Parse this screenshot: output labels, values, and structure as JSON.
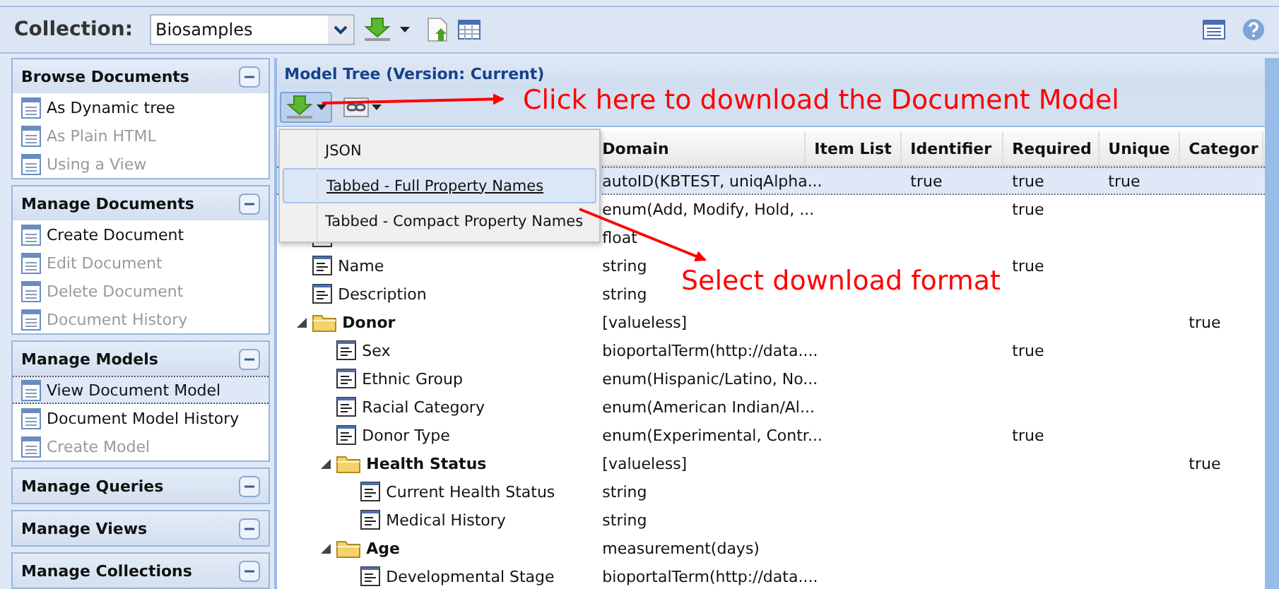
{
  "toolbar": {
    "collection_label": "Collection:",
    "collection_value": "Biosamples"
  },
  "sidebar": {
    "sections": [
      {
        "title": "Browse Documents",
        "items": [
          {
            "label": "As Dynamic tree",
            "disabled": false,
            "selected": false
          },
          {
            "label": "As Plain HTML",
            "disabled": true,
            "selected": false
          },
          {
            "label": "Using a View",
            "disabled": true,
            "selected": false
          }
        ]
      },
      {
        "title": "Manage Documents",
        "items": [
          {
            "label": "Create Document",
            "disabled": false,
            "selected": false
          },
          {
            "label": "Edit Document",
            "disabled": true,
            "selected": false
          },
          {
            "label": "Delete Document",
            "disabled": true,
            "selected": false
          },
          {
            "label": "Document History",
            "disabled": true,
            "selected": false
          }
        ]
      },
      {
        "title": "Manage Models",
        "items": [
          {
            "label": "View Document Model",
            "disabled": false,
            "selected": true
          },
          {
            "label": "Document Model History",
            "disabled": false,
            "selected": false
          },
          {
            "label": "Create Model",
            "disabled": true,
            "selected": false
          }
        ]
      },
      {
        "title": "Manage Queries"
      },
      {
        "title": "Manage Views"
      },
      {
        "title": "Manage Collections"
      }
    ]
  },
  "panel": {
    "title": "Model Tree (Version: Current)",
    "columns": [
      "Domain",
      "Item List",
      "Identifier",
      "Required",
      "Unique",
      "Categor"
    ],
    "tree": [
      {
        "kind": "covered",
        "selected": true,
        "domain": "autoID(KBTEST, uniqAlpha...",
        "identifier": "true",
        "required": "true",
        "unique": "true"
      },
      {
        "kind": "covered",
        "selected": false,
        "domain": "enum(Add, Modify, Hold, ...",
        "required": "true"
      },
      {
        "kind": "field",
        "selected": false,
        "domain": "float"
      },
      {
        "kind": "field",
        "selected": false,
        "name": "Name",
        "domain": "string",
        "required": "true"
      },
      {
        "kind": "field",
        "selected": false,
        "name": "Description",
        "domain": "string"
      },
      {
        "kind": "group",
        "selected": false,
        "name": "Donor",
        "domain": "[valueless]",
        "category": "true",
        "children": [
          {
            "kind": "field",
            "selected": false,
            "name": "Sex",
            "domain": "bioportalTerm(http://data....",
            "required": "true"
          },
          {
            "kind": "field",
            "selected": false,
            "name": "Ethnic Group",
            "domain": "enum(Hispanic/Latino, No..."
          },
          {
            "kind": "field",
            "selected": false,
            "name": "Racial Category",
            "domain": "enum(American Indian/Al..."
          },
          {
            "kind": "field",
            "selected": false,
            "name": "Donor Type",
            "domain": "enum(Experimental, Contr...",
            "required": "true"
          },
          {
            "kind": "group",
            "selected": false,
            "name": "Health Status",
            "domain": "[valueless]",
            "category": "true",
            "children": [
              {
                "kind": "field",
                "selected": false,
                "name": "Current Health Status",
                "domain": "string"
              },
              {
                "kind": "field",
                "selected": false,
                "name": "Medical History",
                "domain": "string"
              }
            ]
          },
          {
            "kind": "group",
            "selected": false,
            "name": "Age",
            "domain": "measurement(days)",
            "children": [
              {
                "kind": "field",
                "selected": false,
                "name": "Developmental Stage",
                "domain": "bioportalTerm(http://data...."
              }
            ]
          }
        ]
      }
    ]
  },
  "download_menu": [
    {
      "label": "JSON",
      "selected": false
    },
    {
      "label": "Tabbed - Full Property Names",
      "selected": true
    },
    {
      "label": "Tabbed - Compact Property Names",
      "selected": false
    }
  ],
  "annotations": [
    {
      "text": "Click here to download the Document Model"
    },
    {
      "text": "Select download format"
    }
  ]
}
